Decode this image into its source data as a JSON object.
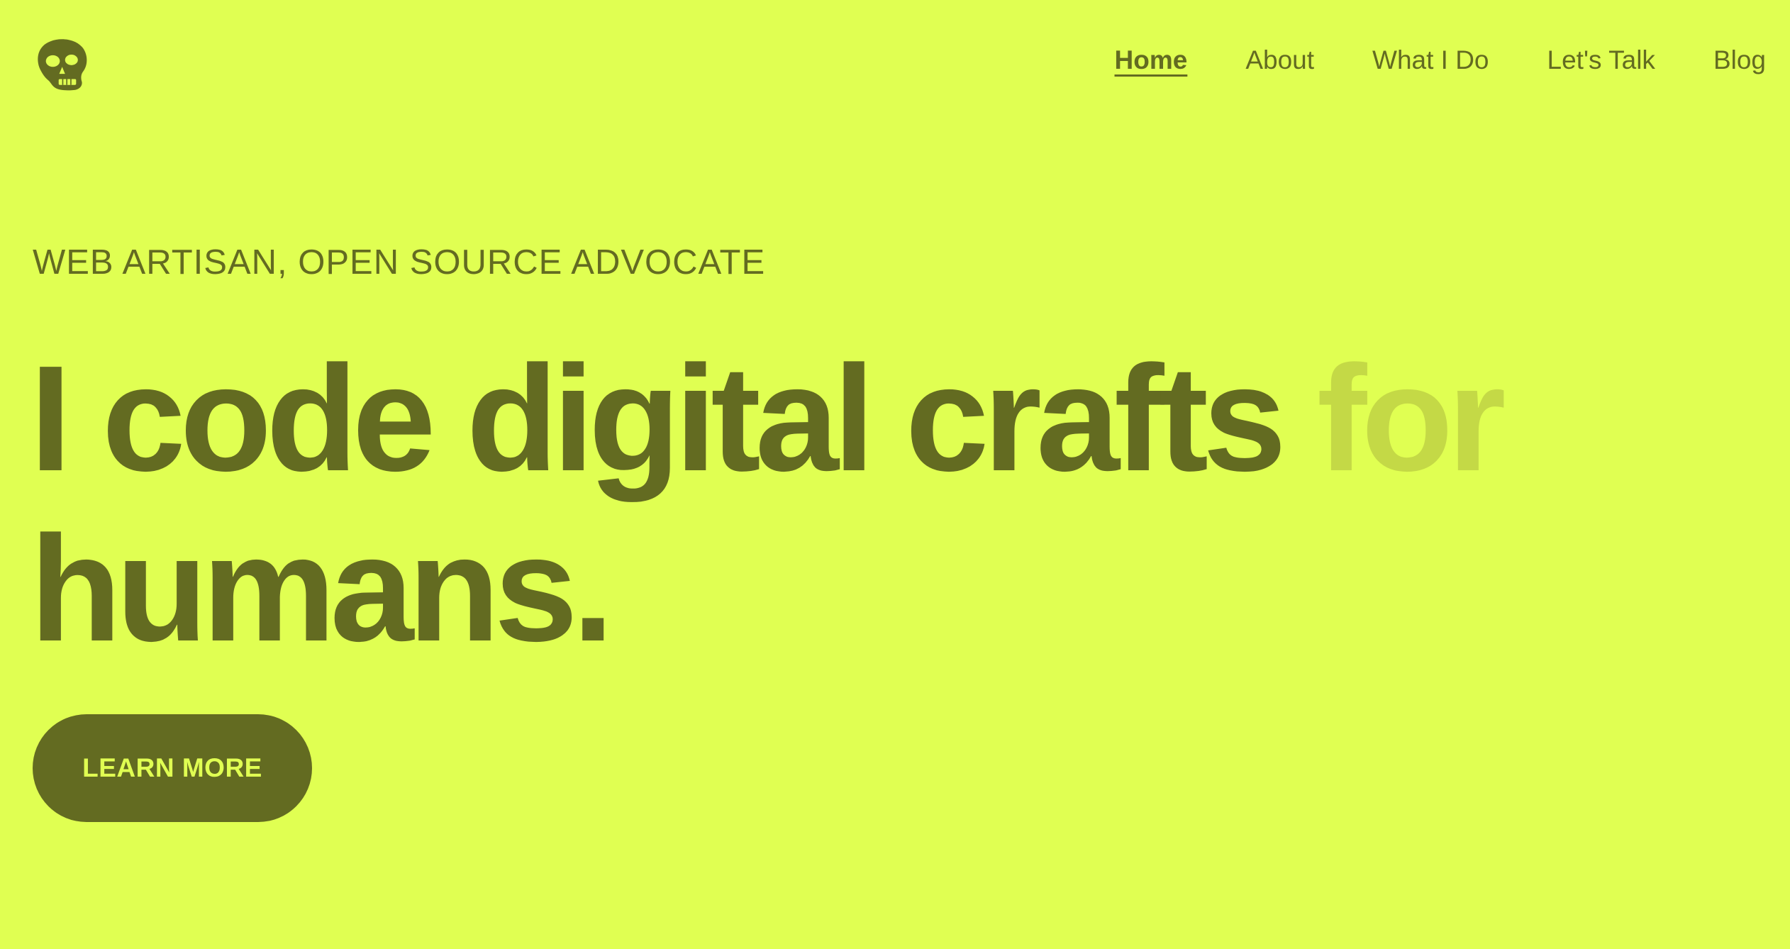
{
  "colors": {
    "background": "#e0ff52",
    "primary": "#636b21",
    "muted_text": "#c4d946"
  },
  "header": {
    "logo_icon": "skull-icon",
    "nav": [
      {
        "label": "Home",
        "active": true
      },
      {
        "label": "About",
        "active": false
      },
      {
        "label": "What I Do",
        "active": false
      },
      {
        "label": "Let's Talk",
        "active": false
      },
      {
        "label": "Blog",
        "active": false
      }
    ]
  },
  "hero": {
    "eyebrow": "WEB ARTISAN, OPEN SOURCE ADVOCATE",
    "headline_main": "I code digital crafts",
    "headline_muted": "for",
    "headline_end": "humans.",
    "cta_label": "LEARN MORE"
  }
}
